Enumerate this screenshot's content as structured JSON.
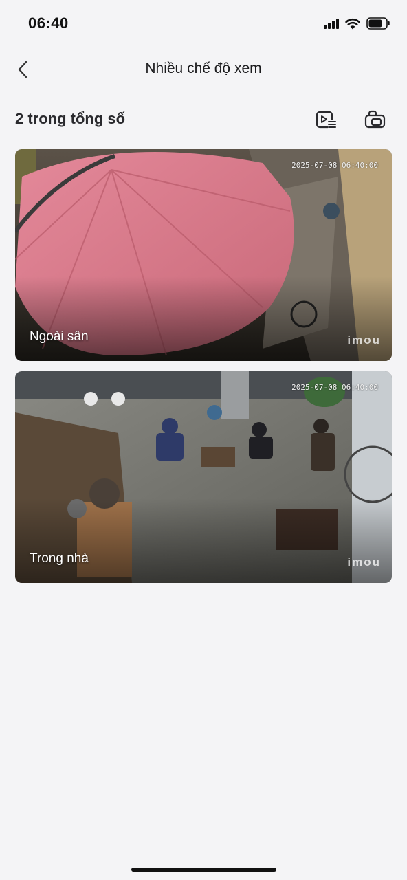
{
  "status_bar": {
    "time": "06:40"
  },
  "nav": {
    "title": "Nhiều chế độ xem"
  },
  "header": {
    "count_label": "2 trong tổng số",
    "playlist_icon": "playlist-play-icon",
    "layout_icon": "window-layout-icon"
  },
  "cameras": [
    {
      "name": "Ngoài sân",
      "timestamp": "2025-07-08 06:40:00",
      "watermark": "imou"
    },
    {
      "name": "Trong nhà",
      "timestamp": "2025-07-08 06:40:00",
      "watermark": "imou"
    }
  ],
  "colors": {
    "background": "#f4f4f6",
    "text": "#1c1c1e"
  }
}
